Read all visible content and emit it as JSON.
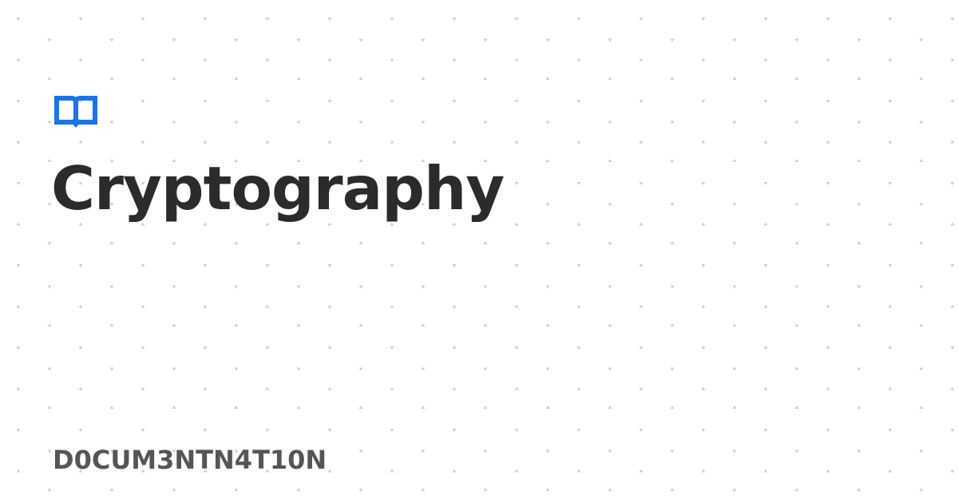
{
  "brand": {
    "logo_icon": "book-icon",
    "accent_color": "#1a73e8"
  },
  "page": {
    "title": "Cryptography",
    "site_name": "D0CUM3NTN4T10N"
  },
  "background": {
    "color": "#ffffff",
    "pattern_icon": "small-triangle-dot-icon",
    "pattern_color": "#cfcfcf"
  },
  "text_colors": {
    "title": "#2b2b2b",
    "site_name": "#555555"
  }
}
